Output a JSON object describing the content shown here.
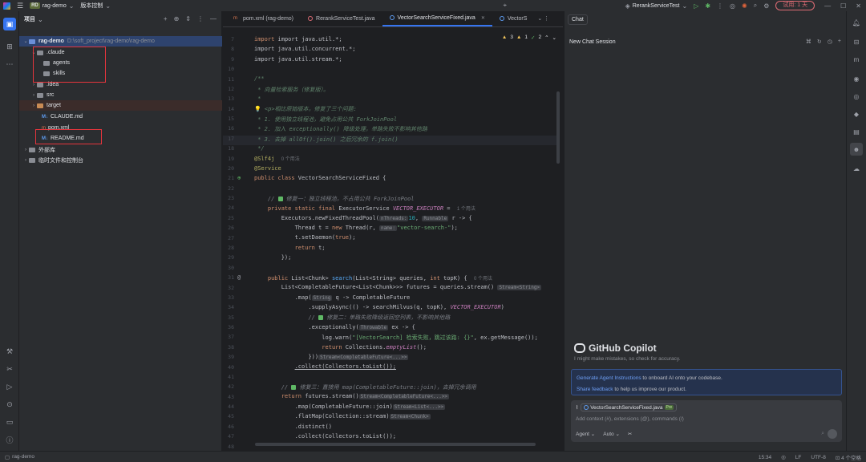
{
  "titlebar": {
    "project_badge": "RD",
    "project_name": "rag-demo",
    "vcs_label": "版本控制",
    "run_config": "RerankServiceTest",
    "trial_label": "试用: 1 天"
  },
  "project_panel": {
    "title": "项目",
    "tree": [
      {
        "label": "rag-demo",
        "path": "D:\\soft_project\\rag-demo\\rag-demo"
      },
      {
        "label": ".claude"
      },
      {
        "label": "agents"
      },
      {
        "label": "skills"
      },
      {
        "label": ".idea"
      },
      {
        "label": "src"
      },
      {
        "label": "target"
      },
      {
        "label": "CLAUDE.md"
      },
      {
        "label": "pom.xml"
      },
      {
        "label": "README.md"
      },
      {
        "label": "外部库"
      },
      {
        "label": "临时文件和控制台"
      }
    ]
  },
  "editor": {
    "tabs": [
      {
        "label": "pom.xml (rag-demo)"
      },
      {
        "label": "RerankServiceTest.java"
      },
      {
        "label": "VectorSearchServiceFixed.java"
      },
      {
        "label": "VectorS"
      }
    ],
    "inspections": {
      "warnings": "3",
      "weak": "1",
      "typos": "2"
    },
    "line_numbers": [
      "7",
      "8",
      "9",
      "10",
      "11",
      "12",
      "13",
      "14",
      "15",
      "16",
      "17",
      "18",
      "19",
      "20",
      "21",
      "22",
      "23",
      "24",
      "25",
      "26",
      "27",
      "28",
      "29",
      "30",
      "31",
      "32",
      "33",
      "34",
      "35",
      "36",
      "37",
      "38",
      "39",
      "40",
      "41",
      "42",
      "43",
      "44",
      "45",
      "46",
      "47",
      "48"
    ],
    "code": {
      "l7": "import java.util.*;",
      "l8": "import java.util.concurrent.*;",
      "l9": "import java.util.stream.*;",
      "l11": "/**",
      "l12": " * 向量检索服务（修复版）。",
      "l13": " *",
      "l14": " <p>相比原始版本，修复了三个问题:",
      "l15": " * 1. 使用独立线程池，避免占用公共 ForkJoinPool",
      "l16": " * 2. 加入 exceptionally() 降级处理，单路失败不影响其他路",
      "l17": " * 3. 去掉 allOf().join() 之后冗余的 f.join()",
      "l18": " */",
      "l19_ann": "@Slf4j",
      "l19_usage": "0 个用法",
      "l20": "@Service",
      "l21_kw": "public class",
      "l21_name": "VectorSearchServiceFixed {",
      "l23": "修复一：独立线程池，不占用公共 ForkJoinPool",
      "l24_kw": "private static final",
      "l24_type": "ExecutorService",
      "l24_field": "VECTOR_EXECUTOR",
      "l24_rest": " =",
      "l24_usage": "1 个用法",
      "l25_a": "Executors.newFixedThreadPool(",
      "l25_hint1": "nThreads:",
      "l25_num": "10",
      "l25_hint2": "Runnable",
      "l25_b": " r -> {",
      "l26_a": "Thread t = ",
      "l26_kw": "new",
      "l26_b": " Thread(r, ",
      "l26_hint": "name:",
      "l26_str": "\"vector-search-\"",
      "l26_c": ");",
      "l27_a": "t.setDaemon(",
      "l27_kw": "true",
      "l27_b": ");",
      "l28_kw": "return",
      "l28_b": " t;",
      "l29": "});",
      "l31_kw": "public",
      "l31_a": " List<Chunk> ",
      "l31_m": "search",
      "l31_b": "(List<String> queries, ",
      "l31_kw2": "int",
      "l31_c": " topK) {",
      "l31_usage": "0 个用法",
      "l32": "List<CompletableFuture<List<Chunk>>> futures = queries.stream()",
      "l32_hint": "Stream<String>",
      "l33_a": ".map(",
      "l33_hint": "String",
      "l33_b": " q -> CompletableFuture",
      "l34_a": ".supplyAsync(() -> searchMilvus(q, topK), ",
      "l34_field": "VECTOR_EXECUTOR",
      "l34_b": ")",
      "l35": "修复二：单路失败降级返回空列表，不影响其他路",
      "l36_a": ".exceptionally(",
      "l36_hint": "Throwable",
      "l36_b": " ex -> {",
      "l37_a": "log.warn(",
      "l37_str": "\"[VectorSearch] 检索失败，跳过该路: {}\"",
      "l37_b": ", ex.getMessage());",
      "l38_kw": "return",
      "l38_b": " Collections.",
      "l38_m": "emptyList",
      "l38_c": "();",
      "l39_a": "}))",
      "l39_hint": "Stream<CompletableFuture<...>>",
      "l40": ".collect(Collectors.toList());",
      "l42": "修复三：直接用 map(CompletableFuture::join)，去掉冗余调用",
      "l43_kw": "return",
      "l43_a": " futures.stream()",
      "l43_hint": "Stream<CompletableFuture<...>>",
      "l44_a": ".map(CompletableFuture::join)",
      "l44_hint": "Stream<List<...>>",
      "l45_a": ".flatMap(Collection::stream)",
      "l45_hint": "Stream<Chunk>",
      "l46": ".distinct()",
      "l47": ".collect(Collectors.toList());"
    }
  },
  "chat": {
    "tab_label": "Chat",
    "session_title": "New Chat Session",
    "copilot_title": "GitHub Copilot",
    "copilot_subtitle": "I might make mistakes, so check for accuracy.",
    "onboard_link1": "Generate Agent Instructions",
    "onboard_text1": " to onboard AI onto your codebase.",
    "onboard_link2": "Share feedback",
    "onboard_text2": " to help us improve our product.",
    "file_chip": "VectorSearchServiceFixed.java",
    "file_chip_badge": "Pre",
    "input_placeholder": "Add context (#), extensions (@), commands (/)",
    "mode": "Agent",
    "model": "Auto"
  },
  "statusbar": {
    "project": "rag-demo",
    "time": "15:34",
    "line_sep": "LF",
    "encoding": "UTF-8",
    "indent": "4 个空格"
  }
}
